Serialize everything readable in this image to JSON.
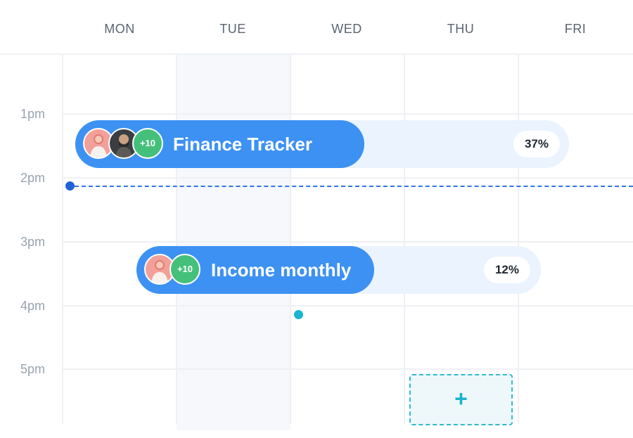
{
  "days": [
    "MON",
    "TUE",
    "WED",
    "THU",
    "FRI"
  ],
  "times": [
    "1pm",
    "2pm",
    "3pm",
    "4pm",
    "5pm"
  ],
  "events": [
    {
      "title": "Finance Tracker",
      "more_label": "+10",
      "percent": "37%",
      "color": "#3d91f2"
    },
    {
      "title": "Income monthly",
      "more_label": "+10",
      "percent": "12%",
      "color": "#3d91f2"
    }
  ],
  "add_slot": {
    "icon": "plus-icon",
    "glyph": "+"
  },
  "colors": {
    "accent": "#3d91f2",
    "track": "#eaf3fe",
    "now_line": "#2f74e4",
    "avatar_more": "#45c07b",
    "add_slot": "#19b3cf"
  }
}
